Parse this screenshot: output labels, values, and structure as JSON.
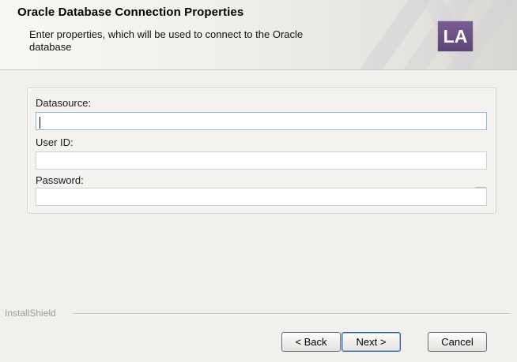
{
  "header": {
    "title": "Oracle Database Connection Properties",
    "subtitle": "Enter properties, which will be used to connect to the Oracle database",
    "logo_text": "LA"
  },
  "form": {
    "datasource": {
      "label": "Datasource:",
      "value": ""
    },
    "user_id": {
      "label": "User ID:",
      "value": ""
    },
    "password": {
      "label": "Password:",
      "value": ""
    }
  },
  "footer": {
    "brand": "InstallShield"
  },
  "buttons": {
    "back": "< Back",
    "next": "Next >",
    "cancel": "Cancel"
  },
  "colors": {
    "logo": "#6b4f88",
    "focus_border": "#8fb8d9",
    "primary_button_border": "#2d5b9c"
  }
}
